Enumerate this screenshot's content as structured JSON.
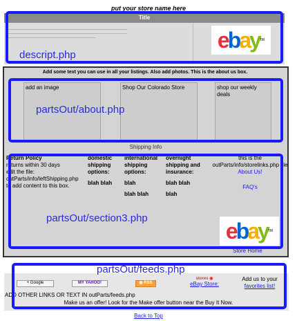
{
  "header": {
    "store_name": "put your store name here",
    "title": "Title"
  },
  "descript": {
    "label": "descript.php"
  },
  "ebay_logo": {
    "letters": [
      "e",
      "b",
      "a",
      "y"
    ],
    "colors": [
      "#e53238",
      "#0064d2",
      "#f5af02",
      "#86b817"
    ],
    "tm": "TM"
  },
  "about": {
    "heading": "Add some text you can use in all your listings. Also add photos. This is the about us box.",
    "columns": [
      "add an image",
      "Shop Our Colorado Store",
      "shop our weekly deals"
    ],
    "label": "partsOut/about.php",
    "shipping_info": "Shipping Info"
  },
  "section3": {
    "return_policy_title": "Return Policy",
    "return_policy_text": [
      "returns within 30 days",
      "edit the file:",
      "outParts/info/leftShipping.php",
      "to add content to this box."
    ],
    "domestic_title": "domestic shipping options:",
    "domestic_value": "blah blah",
    "international_title": "international shipping options:",
    "international_values": [
      "blah",
      "blah blah"
    ],
    "overnight_title": "overnight shipping and insurance:",
    "overnight_values": [
      "blah blah",
      "blah"
    ],
    "right_text": "this is the outParts/info/storelinks.php file",
    "about_us_link": "About Us!",
    "faq_link": "FAQ's",
    "store_home_link": "Store Home",
    "label": "partsOut/section3.php"
  },
  "feeds": {
    "label": "partsOut/feeds.php",
    "google_badge": "+ Google",
    "yahoo_badge": "MY YAHOO!",
    "rss_badge": "RSS",
    "ebay_stores_brand": "stores",
    "ebay_store_link": "eBay Store:",
    "add_us_text": "Add us to your",
    "favorites_link": "favorites list!",
    "other_links_text": "ADD OTHER LINKS OR TEXT IN outParts/feeds.php",
    "make_offer_text": "Make us an offer! Look for the Make offer button near the Buy It Now."
  },
  "footer": {
    "back_to_top": "Back to Top"
  }
}
